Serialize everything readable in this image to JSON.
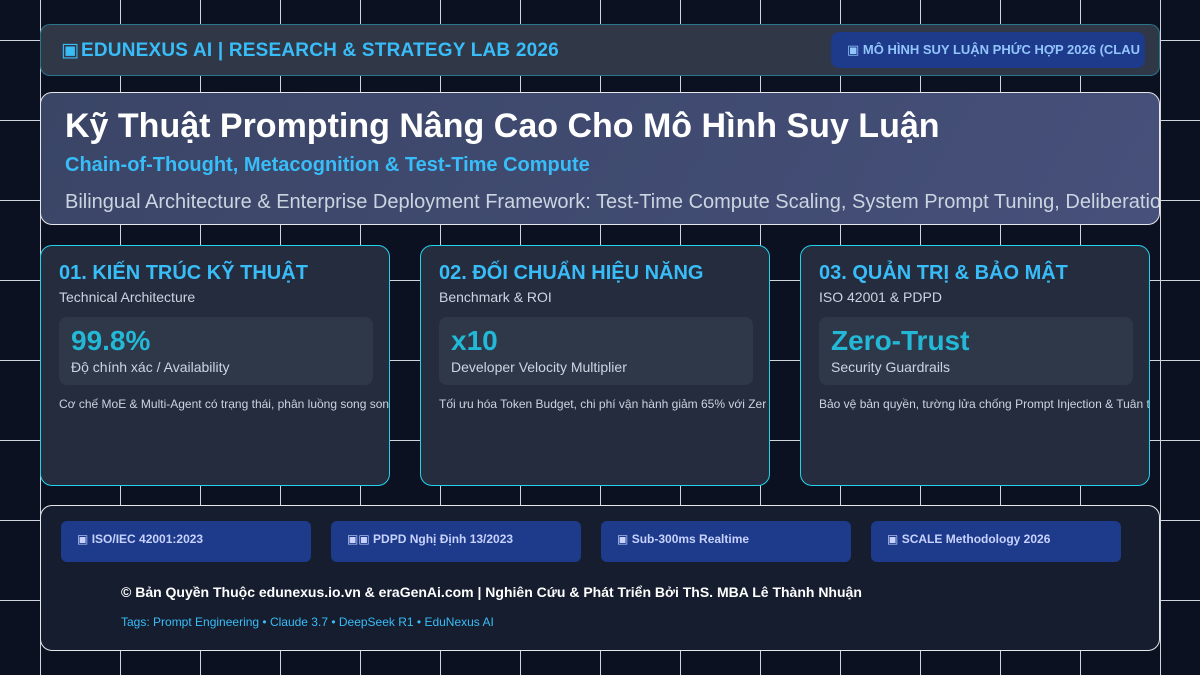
{
  "header": {
    "brand_icon": "▣",
    "brand": "EDUNEXUS AI | RESEARCH & STRATEGY LAB 2026",
    "pill_icon": "▣",
    "pill": "MÔ HÌNH SUY LUẬN PHỨC HỢP 2026 (CLAU"
  },
  "hero": {
    "title": "Kỹ Thuật Prompting Nâng Cao Cho Mô Hình Suy Luận",
    "subtitle": "Chain-of-Thought, Metacognition & Test-Time Compute",
    "description": "Bilingual Architecture & Enterprise Deployment Framework: Test-Time Compute Scaling, System Prompt Tuning, Deliberation Pr"
  },
  "cards": [
    {
      "title": "01. KIẾN TRÚC KỸ THUẬT",
      "subtitle": "Technical Architecture",
      "metric_value": "99.8%",
      "metric_label": "Độ chính xác / Availability",
      "note": "Cơ chế MoE & Multi-Agent có trạng thái, phân luồng song son"
    },
    {
      "title": "02. ĐỐI CHUẨN HIỆU NĂNG",
      "subtitle": "Benchmark & ROI",
      "metric_value": "x10",
      "metric_label": "Developer Velocity Multiplier",
      "note": "Tối ưu hóa Token Budget, chi phí vận hành giảm 65% với Zer"
    },
    {
      "title": "03. QUẢN TRỊ & BẢO MẬT",
      "subtitle": "ISO 42001 & PDPD",
      "metric_value": "Zero-Trust",
      "metric_label": "Security Guardrails",
      "note": "Bảo vệ bản quyền, tường lửa chống Prompt Injection & Tuân thủ"
    }
  ],
  "footer": {
    "badges": [
      {
        "icon": "▣",
        "text": "ISO/IEC 42001:2023"
      },
      {
        "icon": "▣▣",
        "text": "PDPD Nghị Định 13/2023"
      },
      {
        "icon": "▣",
        "text": "Sub-300ms Realtime"
      },
      {
        "icon": "▣",
        "text": "SCALE Methodology 2026"
      }
    ],
    "copyright": "© Bản Quyền Thuộc edunexus.io.vn & eraGenAi.com | Nghiên Cứu & Phát Triển Bởi ThS. MBA Lê Thành Nhuận",
    "tags": "Tags: Prompt Engineering • Claude 3.7 • DeepSeek R1 • EduNexus AI"
  },
  "colors": {
    "background": "#0b1121",
    "accent": "#38bdf8",
    "metric": "#22b8d6",
    "badge": "#1e3a8a"
  }
}
